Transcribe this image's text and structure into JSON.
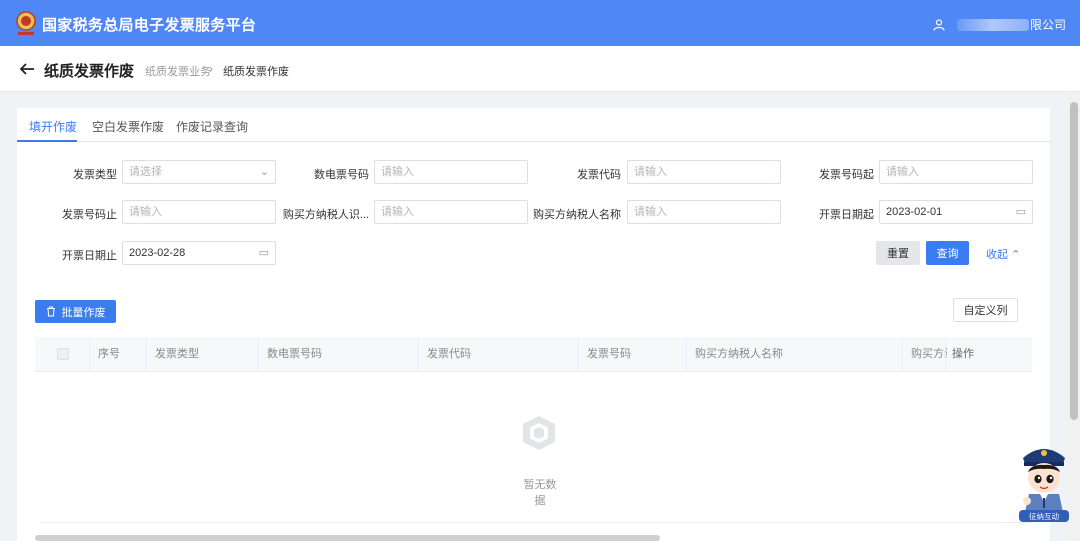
{
  "app": {
    "title": "国家税务总局电子发票服务平台",
    "user_suffix": "限公司"
  },
  "header": {
    "page_title": "纸质发票作废",
    "breadcrumb_parent": "纸质发票业务",
    "breadcrumb_sep": "›",
    "breadcrumb_current": "纸质发票作废"
  },
  "tabs": [
    {
      "label": "填开作废"
    },
    {
      "label": "空白发票作废"
    },
    {
      "label": "作废记录查询"
    }
  ],
  "form": {
    "invoice_type": {
      "label": "发票类型",
      "placeholder": "请选择"
    },
    "digital_invoice_no": {
      "label": "数电票号码",
      "placeholder": "请输入"
    },
    "invoice_code": {
      "label": "发票代码",
      "placeholder": "请输入"
    },
    "invoice_no_from": {
      "label": "发票号码起",
      "placeholder": "请输入"
    },
    "invoice_no_to": {
      "label": "发票号码止",
      "placeholder": "请输入"
    },
    "buyer_tax_id": {
      "label": "购买方纳税人识...",
      "placeholder": "请输入"
    },
    "buyer_name": {
      "label": "购买方纳税人名称",
      "placeholder": "请输入"
    },
    "date_from": {
      "label": "开票日期起",
      "value": "2023-02-01"
    },
    "date_to": {
      "label": "开票日期止",
      "value": "2023-02-28"
    }
  },
  "actions": {
    "reset": "重置",
    "query": "查询",
    "collapse": "收起",
    "batch_void": "批量作废",
    "custom_columns": "自定义列"
  },
  "table": {
    "columns": [
      "序号",
      "发票类型",
      "数电票号码",
      "发票代码",
      "发票号码",
      "购买方纳税人名称",
      "购买方纳",
      "操作"
    ],
    "empty_text": "暂无数据"
  },
  "mascot_caption": "征纳互动",
  "colors": {
    "primary": "#3b7df1",
    "topbar": "#4f87f5"
  }
}
